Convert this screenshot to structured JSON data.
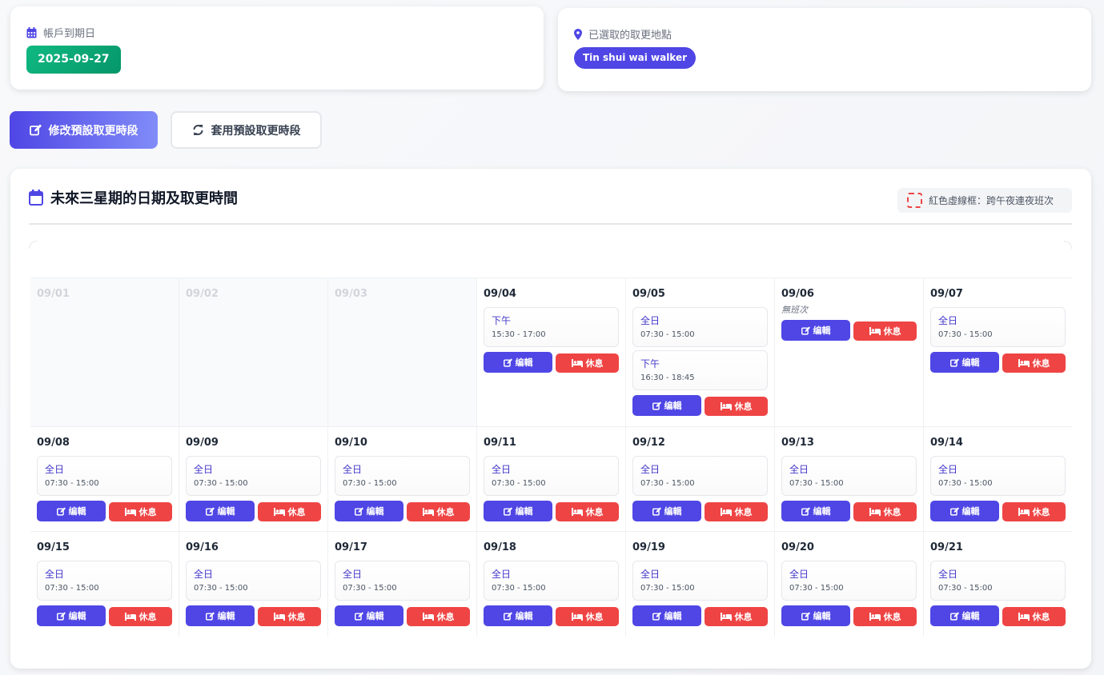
{
  "expiry": {
    "label": "帳戶到期日",
    "date": "2025-09-27",
    "icon": "calendar-icon",
    "color": "#10b981"
  },
  "location": {
    "label": "已選取的取更地點",
    "value": "Tin shui wai walker",
    "icon": "map-marker-icon",
    "color": "#4f46e5"
  },
  "toolbar": {
    "edit_default_label": "修改預設取更時段",
    "apply_default_label": "套用預設取更時段"
  },
  "calendar": {
    "title": "未來三星期的日期及取更時間",
    "legend_text": "紅色虛線框：跨午夜連夜班次",
    "edit_label": "编輯",
    "rest_label": "休息",
    "no_shift_label": "無班次",
    "days": [
      {
        "date": "09/01",
        "past": true,
        "shifts": []
      },
      {
        "date": "09/02",
        "past": true,
        "shifts": []
      },
      {
        "date": "09/03",
        "past": true,
        "shifts": []
      },
      {
        "date": "09/04",
        "past": false,
        "shifts": [
          {
            "name": "下午",
            "time": "15:30 - 17:00"
          }
        ]
      },
      {
        "date": "09/05",
        "past": false,
        "shifts": [
          {
            "name": "全日",
            "time": "07:30 - 15:00"
          },
          {
            "name": "下午",
            "time": "16:30 - 18:45"
          }
        ]
      },
      {
        "date": "09/06",
        "past": false,
        "shifts": []
      },
      {
        "date": "09/07",
        "past": false,
        "shifts": [
          {
            "name": "全日",
            "time": "07:30 - 15:00"
          }
        ]
      },
      {
        "date": "09/08",
        "past": false,
        "shifts": [
          {
            "name": "全日",
            "time": "07:30 - 15:00"
          }
        ]
      },
      {
        "date": "09/09",
        "past": false,
        "shifts": [
          {
            "name": "全日",
            "time": "07:30 - 15:00"
          }
        ]
      },
      {
        "date": "09/10",
        "past": false,
        "shifts": [
          {
            "name": "全日",
            "time": "07:30 - 15:00"
          }
        ]
      },
      {
        "date": "09/11",
        "past": false,
        "shifts": [
          {
            "name": "全日",
            "time": "07:30 - 15:00"
          }
        ]
      },
      {
        "date": "09/12",
        "past": false,
        "shifts": [
          {
            "name": "全日",
            "time": "07:30 - 15:00"
          }
        ]
      },
      {
        "date": "09/13",
        "past": false,
        "shifts": [
          {
            "name": "全日",
            "time": "07:30 - 15:00"
          }
        ]
      },
      {
        "date": "09/14",
        "past": false,
        "shifts": [
          {
            "name": "全日",
            "time": "07:30 - 15:00"
          }
        ]
      },
      {
        "date": "09/15",
        "past": false,
        "shifts": [
          {
            "name": "全日",
            "time": "07:30 - 15:00"
          }
        ]
      },
      {
        "date": "09/16",
        "past": false,
        "shifts": [
          {
            "name": "全日",
            "time": "07:30 - 15:00"
          }
        ]
      },
      {
        "date": "09/17",
        "past": false,
        "shifts": [
          {
            "name": "全日",
            "time": "07:30 - 15:00"
          }
        ]
      },
      {
        "date": "09/18",
        "past": false,
        "shifts": [
          {
            "name": "全日",
            "time": "07:30 - 15:00"
          }
        ]
      },
      {
        "date": "09/19",
        "past": false,
        "shifts": [
          {
            "name": "全日",
            "time": "07:30 - 15:00"
          }
        ]
      },
      {
        "date": "09/20",
        "past": false,
        "shifts": [
          {
            "name": "全日",
            "time": "07:30 - 15:00"
          }
        ]
      },
      {
        "date": "09/21",
        "past": false,
        "shifts": [
          {
            "name": "全日",
            "time": "07:30 - 15:00"
          }
        ]
      }
    ]
  },
  "colors": {
    "primary": "#4f46e5",
    "danger": "#ef4444",
    "success": "#10b981"
  }
}
